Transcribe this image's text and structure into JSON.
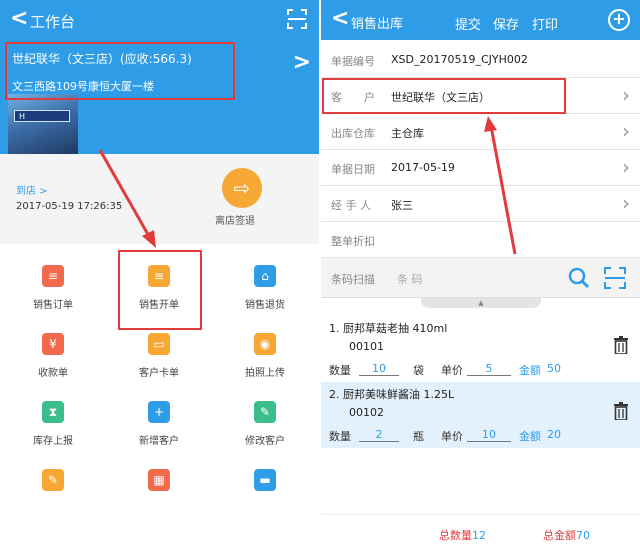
{
  "left": {
    "header": {
      "title": "工作台"
    },
    "store": {
      "name": "世纪联华（文三店）(应收:566.3)",
      "address": "文三西路109号康恒大厦一楼",
      "sign_text": "H"
    },
    "checkin": {
      "arrive_label": "到店",
      "time": "2017-05-19 17:26:35",
      "button_label": "离店签退"
    },
    "menu": [
      {
        "label": "销售订单",
        "icon": "order-icon",
        "color": "#f16a4b"
      },
      {
        "label": "销售开单",
        "icon": "bill-icon",
        "color": "#f7a733"
      },
      {
        "label": "销售退货",
        "icon": "return-icon",
        "color": "#2f9ce8"
      },
      {
        "label": "收款单",
        "icon": "receipt-icon",
        "color": "#f16a4b"
      },
      {
        "label": "客户卡单",
        "icon": "card-icon",
        "color": "#f7a733"
      },
      {
        "label": "拍照上传",
        "icon": "camera-icon",
        "color": "#f7a733"
      },
      {
        "label": "库存上报",
        "icon": "hourglass-icon",
        "color": "#3bbd8c"
      },
      {
        "label": "新增客户",
        "icon": "add-user-icon",
        "color": "#2f9ce8"
      },
      {
        "label": "修改客户",
        "icon": "edit-user-icon",
        "color": "#3bbd8c"
      },
      {
        "label": "",
        "icon": "note-icon",
        "color": "#f7a733"
      },
      {
        "label": "",
        "icon": "calendar-icon",
        "color": "#f16a4b"
      },
      {
        "label": "",
        "icon": "truck-icon",
        "color": "#2f9ce8"
      }
    ]
  },
  "right": {
    "header": {
      "title": "销售出库",
      "submit": "提交",
      "save": "保存",
      "print": "打印"
    },
    "fields": [
      {
        "key": "单据编号",
        "value": "XSD_20170519_CJYH002",
        "chevron": false
      },
      {
        "key": "客　　户",
        "value": "世纪联华（文三店）",
        "chevron": true
      },
      {
        "key": "出库仓库",
        "value": "主仓库",
        "chevron": true
      },
      {
        "key": "单据日期",
        "value": "2017-05-19",
        "chevron": true
      },
      {
        "key": "经 手 人",
        "value": "张三",
        "chevron": true
      },
      {
        "key": "整单折扣",
        "value": "",
        "chevron": false
      }
    ],
    "scan": {
      "label": "条码扫描",
      "placeholder": "条  码"
    },
    "items": [
      {
        "name": "1.  厨邦草菇老抽 410ml",
        "code": "00101",
        "qty_label": "数量",
        "qty": "10",
        "unit": "袋",
        "price_label": "单价",
        "price": "5",
        "amount_label": "金额",
        "amount": "50"
      },
      {
        "name": "2.  厨邦美味鲜酱油 1.25L",
        "code": "00102",
        "qty_label": "数量",
        "qty": "2",
        "unit": "瓶",
        "price_label": "单价",
        "price": "10",
        "amount_label": "金额",
        "amount": "20"
      }
    ],
    "footer": {
      "total_qty_label": "总数量",
      "total_qty": "12",
      "total_amount_label": "总金额",
      "total_amount": "70"
    }
  },
  "colors": {
    "header_blue": "#2f9ce8",
    "highlight_red": "#e23b3b",
    "selected_row": "#e3f1fc"
  }
}
